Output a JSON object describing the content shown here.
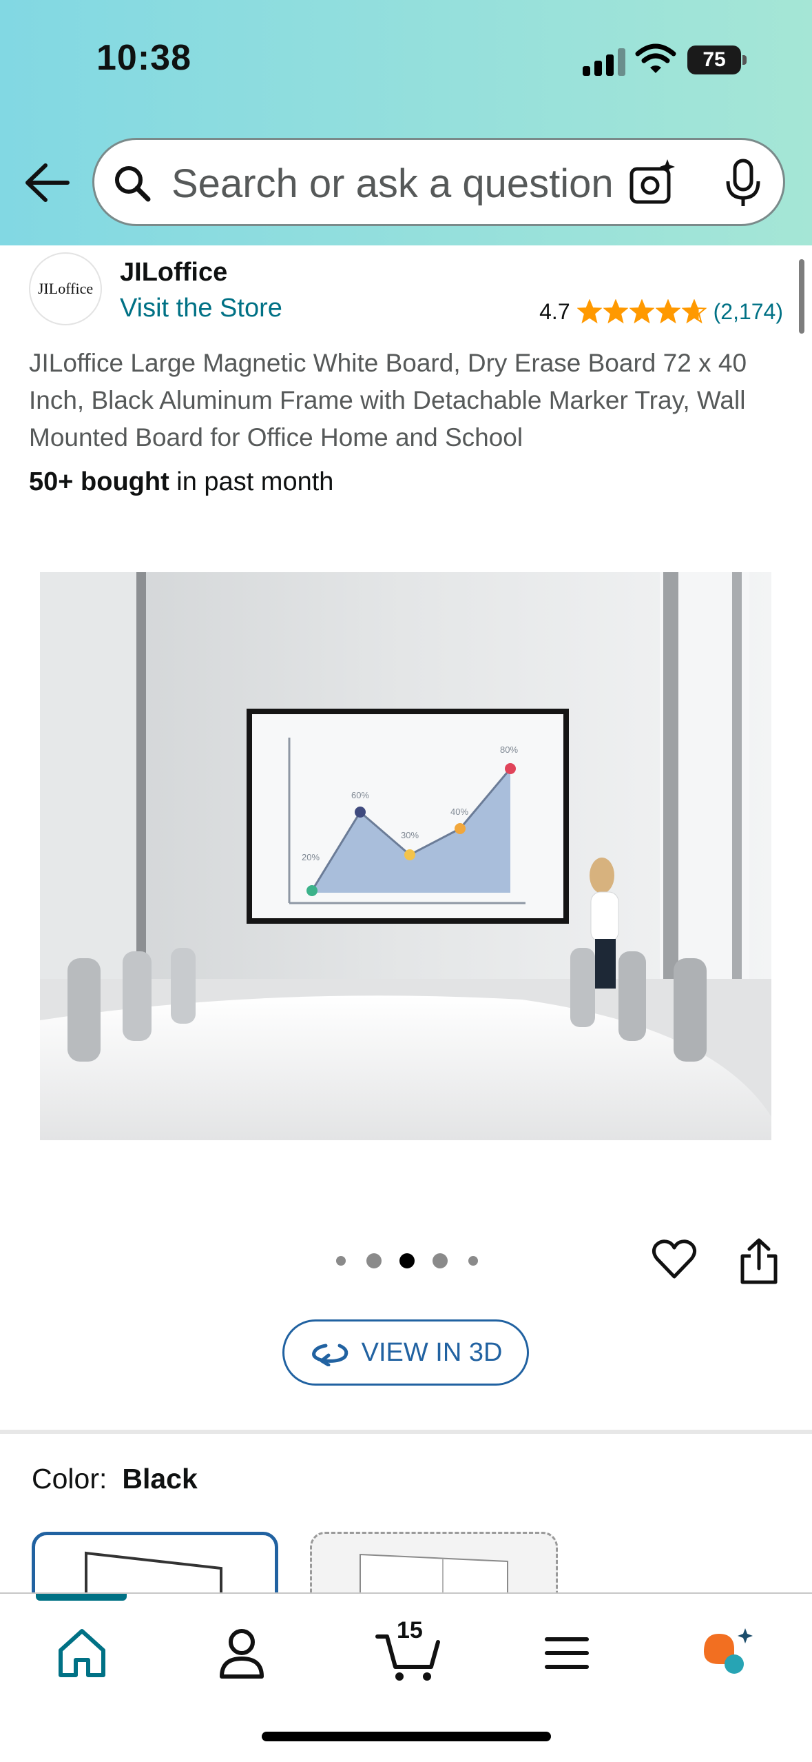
{
  "status_bar": {
    "time": "10:38",
    "battery": "75"
  },
  "search": {
    "placeholder": "Search or ask a question"
  },
  "brand": {
    "logo_text": "JILoffice",
    "name": "JILoffice",
    "visit_store": "Visit the Store",
    "rating": "4.7",
    "stars": 4.7,
    "reviews": "(2,174)"
  },
  "product": {
    "title": "JILoffice Large Magnetic White Board, Dry Erase Board 72 x 40 Inch, Black Aluminum Frame with Detachable Marker Tray, Wall Mounted Board for Office Home and School",
    "bought_strong": "50+ bought",
    "bought_rest": " in past month",
    "image_chart_labels": [
      "20%",
      "60%",
      "30%",
      "40%",
      "80%"
    ]
  },
  "carousel": {
    "dot_count": 5,
    "active_index": 2
  },
  "view3d_label": "VIEW IN 3D",
  "color": {
    "label": "Color:",
    "value": "Black"
  },
  "nav": {
    "cart_count": "15",
    "items": [
      "home-icon",
      "account-icon",
      "cart-icon",
      "menu-icon",
      "rufus-icon"
    ]
  },
  "colors": {
    "link": "#007185",
    "accent": "#2162a1",
    "star": "#ff9900"
  }
}
